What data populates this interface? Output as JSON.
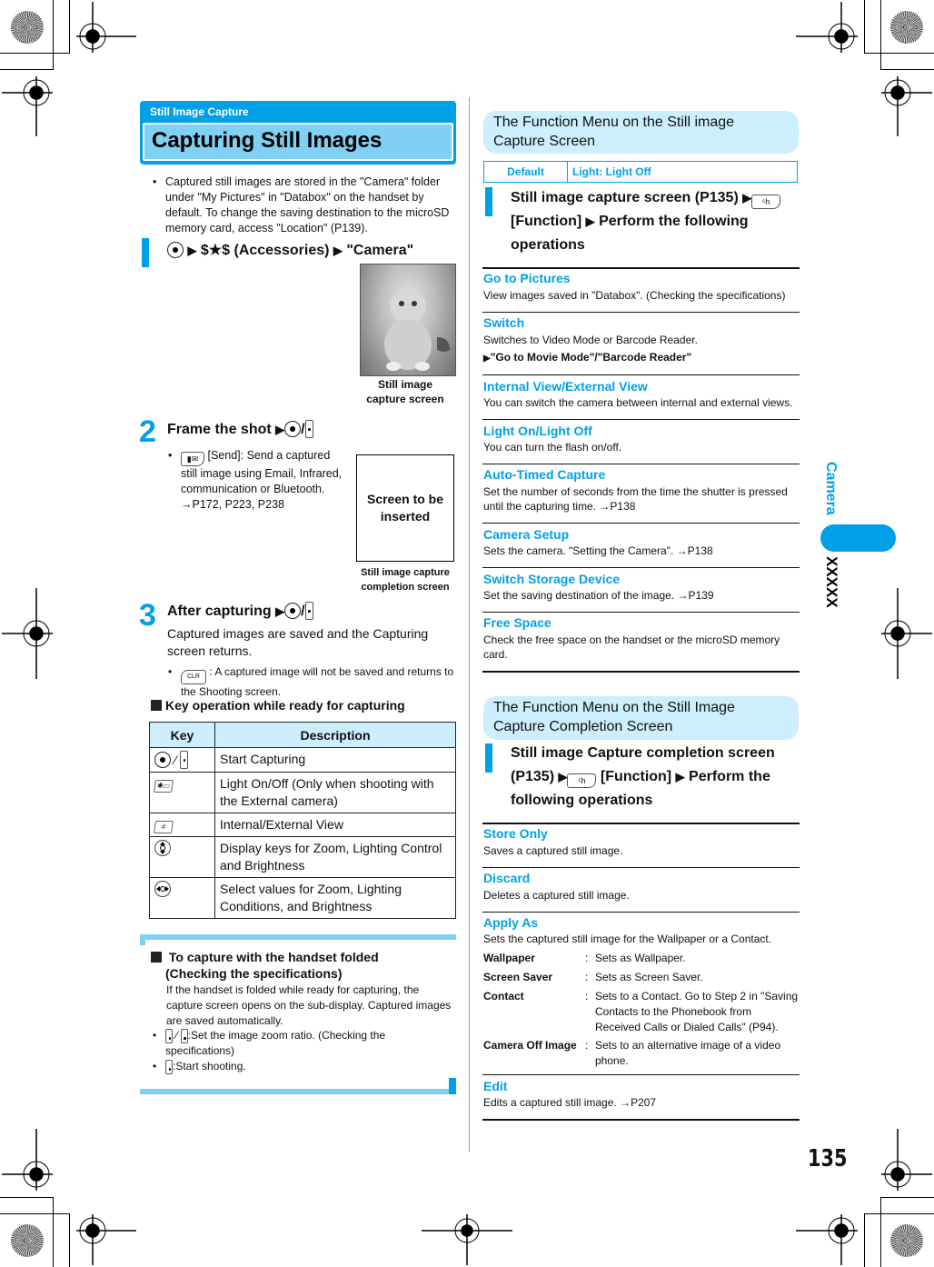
{
  "left": {
    "section_label": "Still Image Capture",
    "section_title": "Capturing Still Images",
    "intro_bullet": "Captured still images are stored in the \"Camera\" folder under \"My Pictures\" in \"Databox\" on the handset by default. To change the saving destination to the microSD memory card, access \"Location\" (P139).",
    "step1": {
      "number": "1",
      "text_a": "$★$ (Accessories)",
      "text_b": "\"Camera\"",
      "image_caption": "Still image capture screen"
    },
    "step2": {
      "number": "2",
      "text": "Frame the shot",
      "bullet_key": "Send",
      "bullet": "[Send]: Send a captured still image using Email, Infrared, communication or Bluetooth. →P172, P223, P238",
      "placeholder": "Screen to be inserted",
      "placeholder_caption": "Still image capture completion screen"
    },
    "step3": {
      "number": "3",
      "text": "After capturing",
      "body": "Captured images are saved and the Capturing screen returns.",
      "bullet": ": A captured image will not be saved and returns to the Shooting screen.",
      "bullet_key": "CLR"
    },
    "key_table": {
      "heading": "Key operation while ready for capturing",
      "headers": [
        "Key",
        "Description"
      ],
      "rows": [
        {
          "key": "center/side",
          "description": "Start Capturing"
        },
        {
          "key": "star",
          "description": "Light On/Off (Only when shooting with the External camera)"
        },
        {
          "key": "hash",
          "description": "Internal/External View"
        },
        {
          "key": "up-down",
          "description": "Display keys for Zoom, Lighting Control and Brightness"
        },
        {
          "key": "left-right",
          "description": "Select values for Zoom, Lighting Conditions, and Brightness"
        }
      ]
    },
    "folded": {
      "heading_line1": "To capture with the handset folded",
      "heading_line2": "(Checking the specifications)",
      "body": "If the handset is folded while ready for capturing, the capture screen opens on the sub-display. Captured images are saved automatically.",
      "bullet1": ":Set the image zoom ratio. (Checking the specifications)",
      "bullet2": ":Start shooting."
    }
  },
  "right": {
    "menu1": {
      "header": "The Function Menu on the Still image Capture Screen",
      "default_label": "Default",
      "default_value": "Light: Light Off",
      "step_number": "1",
      "step_a": "Still image capture screen (P135)",
      "step_b": "[Function]",
      "step_c": "Perform the following operations",
      "items": [
        {
          "title": "Go to Pictures",
          "desc": "View images saved in \"Databox\". (Checking the specifications)"
        },
        {
          "title": "Switch",
          "desc": "Switches to Video Mode or Barcode Reader.",
          "sub": "\"Go to Movie Mode\"/\"Barcode Reader\""
        },
        {
          "title": "Internal View/External View",
          "desc": "You can switch the camera between internal and external views."
        },
        {
          "title": "Light On/Light Off",
          "desc": "You can turn the flash on/off."
        },
        {
          "title": "Auto-Timed Capture",
          "desc": "Set the number of seconds from the time the shutter is pressed until the capturing time. →P138"
        },
        {
          "title": "Camera Setup",
          "desc": "Sets the camera. \"Setting the Camera\". →P138"
        },
        {
          "title": "Switch Storage Device",
          "desc": "Set the saving destination of the image. →P139"
        },
        {
          "title": "Free Space",
          "desc": "Check the free space on the handset or the microSD memory card."
        }
      ]
    },
    "menu2": {
      "header": "The Function Menu on the Still Image Capture Completion Screen",
      "step_number": "1",
      "step_a": "Still image Capture completion screen (P135)",
      "step_b": "[Function]",
      "step_c": "Perform the following operations",
      "items": [
        {
          "title": "Store Only",
          "desc": "Saves a captured still image."
        },
        {
          "title": "Discard",
          "desc": "Deletes a captured still image."
        },
        {
          "title": "Apply As",
          "desc": "Sets the captured still image for the Wallpaper or a Contact."
        },
        {
          "title": "Edit",
          "desc": "Edits a captured still image. →P207"
        }
      ],
      "apply_options": [
        {
          "name": "Wallpaper",
          "desc": "Sets as Wallpaper."
        },
        {
          "name": "Screen Saver",
          "desc": "Sets as Screen Saver."
        },
        {
          "name": "Contact",
          "desc": "Sets to a Contact. Go to Step 2 in \"Saving Contacts to the Phonebook from Received Calls or Dialed Calls\" (P94)."
        },
        {
          "name": "Camera Off Image",
          "desc": "Sets to an alternative image of a video phone."
        }
      ]
    }
  },
  "sidebar": {
    "chapter": "Camera",
    "subchapter": "XXXXX"
  },
  "page_number": "135",
  "colors": {
    "accent": "#00a0e9",
    "light_accent": "#7fd0f2",
    "pale_accent": "#cdeefc"
  }
}
